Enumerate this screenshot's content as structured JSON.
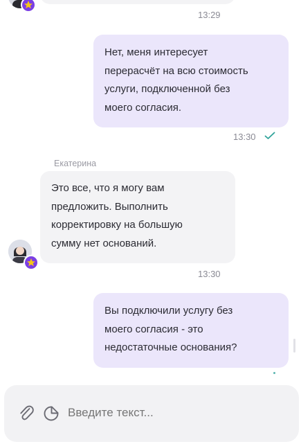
{
  "messages": [
    {
      "direction": "incoming",
      "time": "13:29"
    },
    {
      "direction": "outgoing",
      "text": "Нет, меня интересует\nперерасчёт на всю стоимость\nуслуги, подключенной без\nмоего согласия.",
      "time": "13:30",
      "status_icon": "double-check-icon"
    },
    {
      "direction": "incoming",
      "sender": "Екатерина",
      "text": "Это все, что я могу вам\nпредложить. Выполнить\nкорректировку на большую\nсумму нет оснований.",
      "time": "13:30"
    },
    {
      "direction": "outgoing",
      "text": "Вы подключили услугу без\nмоего согласия - это\nнедостаточные основания?"
    }
  ],
  "composer": {
    "placeholder": "Введите текст...",
    "attach_icon": "paperclip-icon",
    "sticker_icon": "sticker-icon"
  },
  "colors": {
    "outgoing_bubble": "#ebe6fb",
    "incoming_bubble": "#f3f3f5",
    "accent": "#7b3fe4",
    "check": "#2fa39a",
    "badge_star": "#f5c518"
  }
}
